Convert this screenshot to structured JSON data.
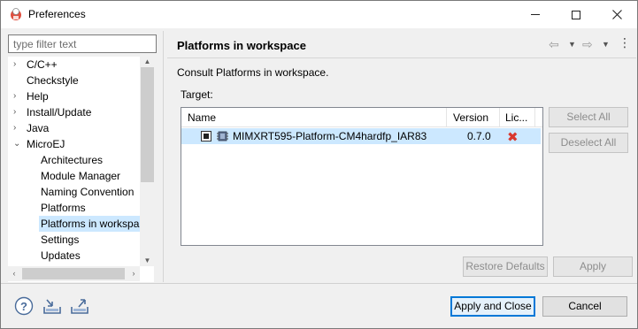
{
  "window": {
    "title": "Preferences"
  },
  "filter": {
    "placeholder": "type filter text"
  },
  "tree": {
    "items": [
      {
        "label": "C/C++",
        "twisty": "›",
        "level": 0
      },
      {
        "label": "Checkstyle",
        "twisty": "",
        "level": 0
      },
      {
        "label": "Help",
        "twisty": "›",
        "level": 0
      },
      {
        "label": "Install/Update",
        "twisty": "›",
        "level": 0
      },
      {
        "label": "Java",
        "twisty": "›",
        "level": 0
      },
      {
        "label": "MicroEJ",
        "twisty": "⌄",
        "level": 0
      },
      {
        "label": "Architectures",
        "twisty": "",
        "level": 1
      },
      {
        "label": "Module Manager",
        "twisty": "",
        "level": 1
      },
      {
        "label": "Naming Convention",
        "twisty": "",
        "level": 1
      },
      {
        "label": "Platforms",
        "twisty": "",
        "level": 1
      },
      {
        "label": "Platforms in workspa",
        "twisty": "",
        "level": 1,
        "selected": true
      },
      {
        "label": "Settings",
        "twisty": "",
        "level": 1
      },
      {
        "label": "Updates",
        "twisty": "",
        "level": 1
      }
    ]
  },
  "page": {
    "title": "Platforms in workspace",
    "description": "Consult Platforms in workspace.",
    "target_label": "Target:"
  },
  "table": {
    "columns": [
      "Name",
      "Version",
      "Lic..."
    ],
    "rows": [
      {
        "name": "MIMXRT595-Platform-CM4hardfp_IAR83",
        "version": "0.7.0",
        "license_icon": "red-x-icon",
        "checked": true
      }
    ]
  },
  "buttons": {
    "select_all": "Select All",
    "deselect_all": "Deselect All",
    "restore_defaults": "Restore Defaults",
    "apply": "Apply",
    "apply_and_close": "Apply and Close",
    "cancel": "Cancel"
  },
  "colors": {
    "selection": "#cce8ff",
    "accent": "#0078d7",
    "error": "#d9382f"
  }
}
